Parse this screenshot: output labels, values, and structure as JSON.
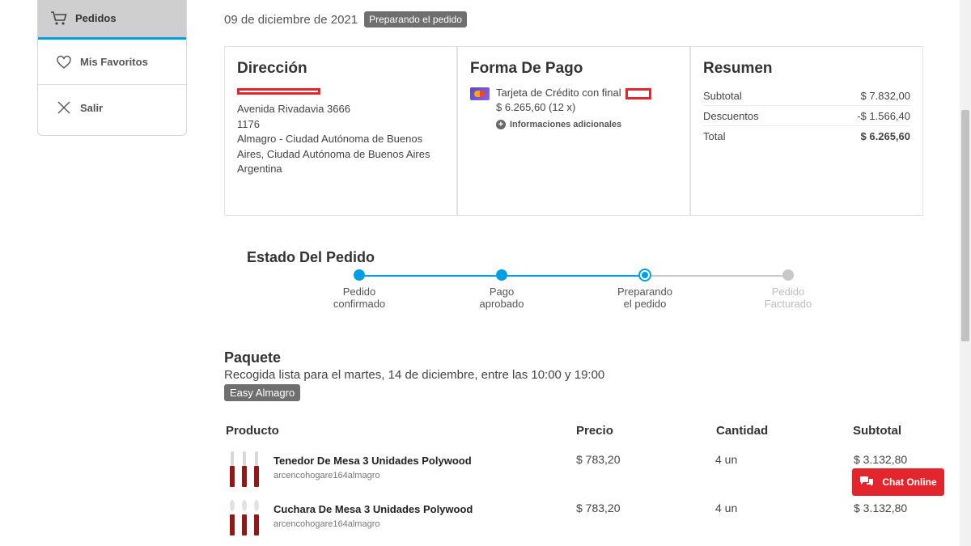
{
  "sidebar": {
    "items": [
      {
        "label": "Pedidos",
        "icon": "cart-icon",
        "active": true
      },
      {
        "label": "Mis Favoritos",
        "icon": "heart-icon"
      },
      {
        "label": "Salir",
        "icon": "close-icon"
      }
    ]
  },
  "order": {
    "date": "09 de diciembre de 2021",
    "status": "Preparando el pedido"
  },
  "address": {
    "title": "Dirección",
    "street": "Avenida Rivadavia 3666",
    "zip": "1176",
    "city": "Almagro - Ciudad Autónoma de Buenos Aires, Ciudad Autónoma de Buenos Aires",
    "country": "Argentina"
  },
  "payment": {
    "title": "Forma De Pago",
    "method": "Tarjeta de Crédito con final",
    "amount": "$ 6.265,60 (12 x)",
    "more_info": "Informaciones adicionales",
    "card_icon": "credit-card-icon"
  },
  "summary": {
    "title": "Resumen",
    "rows": [
      {
        "label": "Subtotal",
        "value": "$ 7.832,00"
      },
      {
        "label": "Descuentos",
        "value": "-$ 1.566,40"
      },
      {
        "label": "Total",
        "value": "$ 6.265,60"
      }
    ]
  },
  "tracker": {
    "title": "Estado Del Pedido",
    "steps": [
      {
        "label": "Pedido\nconfirmado",
        "state": "done"
      },
      {
        "label": "Pago\naprobado",
        "state": "done"
      },
      {
        "label": "Preparando\nel pedido",
        "state": "current"
      },
      {
        "label": "Pedido\nFacturado",
        "state": "pending"
      }
    ],
    "accent": "#009ee3"
  },
  "package": {
    "title": "Paquete",
    "pickup": "Recogida lista para el martes, 14 de diciembre, entre las 10:00 y 19:00",
    "store": "Easy Almagro"
  },
  "products": {
    "headers": {
      "product": "Producto",
      "price": "Precio",
      "qty": "Cantidad",
      "subtotal": "Subtotal"
    },
    "rows": [
      {
        "name": "Tenedor De Mesa 3 Unidades Polywood",
        "sku": "arcencohogare164almagro",
        "price": "$ 783,20",
        "qty": "4 un",
        "subtotal": "$ 3.132,80"
      },
      {
        "name": "Cuchara De Mesa 3 Unidades Polywood",
        "sku": "arcencohogare164almagro",
        "price": "$ 783,20",
        "qty": "4 un",
        "subtotal": "$ 3.132,80"
      }
    ]
  },
  "chat": {
    "label": "Chat Online",
    "icon": "chat-bubbles-icon",
    "color": "#e3262e"
  }
}
